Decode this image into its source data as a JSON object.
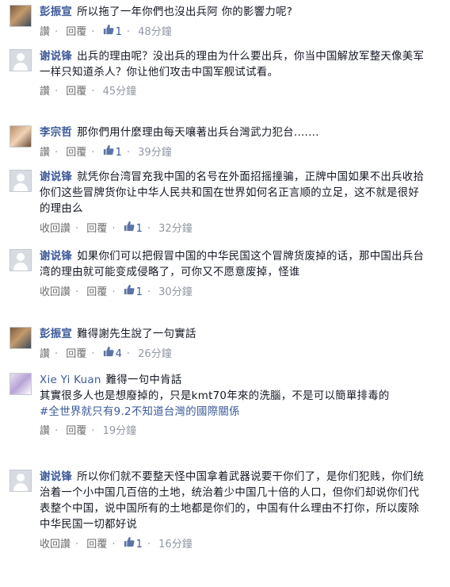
{
  "colors": {
    "link": "#3b5998",
    "muted": "#9197a3",
    "text": "#141823"
  },
  "comments": [
    {
      "author": "彭振宣",
      "text": "所以拖了一年你們也沒出兵阿 你的影響力呢?",
      "actions": {
        "like": "讚",
        "reply": "回覆",
        "likes": "1",
        "time": "48分鐘"
      }
    },
    {
      "author": "谢说锋",
      "text": "出兵的理由呢？没出兵的理由为什么要出兵，你当中国解放军整天像美军一样只知道杀人？你让他们攻击中国军舰试试看。",
      "actions": {
        "like": "讚",
        "reply": "回覆",
        "time": "45分鐘"
      }
    },
    {
      "author": "李宗哲",
      "text": "那你們用什麼理由每天嚷著出兵台灣武力犯台.......",
      "actions": {
        "like": "讚",
        "reply": "回覆",
        "likes": "1",
        "time": "39分鐘"
      }
    },
    {
      "author": "谢说锋",
      "text": "就凭你台湾冒充我中国的名号在外面招摇撞骗，正牌中国如果不出兵收拾你们这些冒牌货你让中华人民共和国在世界如何名正言顺的立足，这不就是很好的理由么",
      "actions": {
        "like": "收回讚",
        "reply": "回覆",
        "likes": "1",
        "time": "32分鐘"
      }
    },
    {
      "author": "谢说锋",
      "text": "如果你们可以把假冒中国的中华民国这个冒牌货废掉的话，那中国出兵台湾的理由就可能变成侵略了，可你又不愿意废掉，怪谁",
      "actions": {
        "like": "收回讚",
        "reply": "回覆",
        "likes": "1",
        "time": "30分鐘"
      }
    },
    {
      "author": "彭振宣",
      "text": "難得謝先生說了一句實話",
      "actions": {
        "like": "讚",
        "reply": "回覆",
        "likes": "4",
        "time": "26分鐘"
      }
    },
    {
      "author": "Xie Yi Kuan",
      "text": "難得一句中肯話",
      "text2": "其實很多人也是想廢掉的，只是kmt70年來的洗腦，不是可以簡單排毒的",
      "hashtag": "#全世界就只有9.2不知道台灣的國際關係",
      "actions": {
        "like": "讚",
        "reply": "回覆",
        "time": "19分鐘"
      }
    },
    {
      "author": "谢说锋",
      "text": "所以你们就不要整天怪中国拿着武器说要干你们了，是你们犯贱，你们统治着一个小中国几百倍的土地，统治着少中国几十倍的人口，但你们却说你们代表整个中国，说中国所有的土地都是你们的，中国有什么理由不打你，所以废除中华民国一切都好说",
      "actions": {
        "like": "收回讚",
        "reply": "回覆",
        "likes": "1",
        "time": "16分鐘"
      }
    }
  ]
}
